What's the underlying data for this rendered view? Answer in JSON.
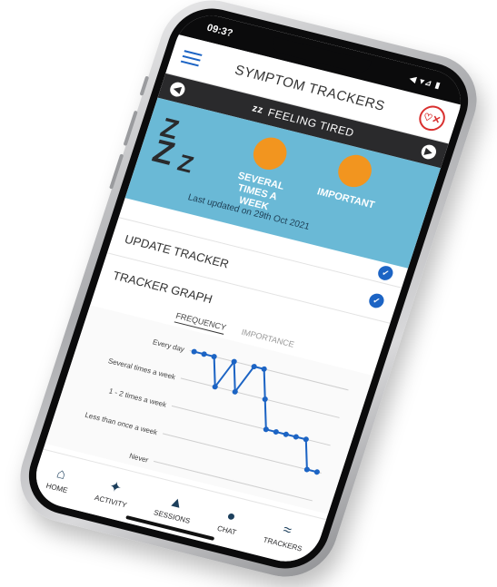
{
  "status_bar": {
    "time": "09:3?",
    "icons": "◀ ▾⊿ ▮"
  },
  "app_bar": {
    "title": "SYMPTOM TRACKERS",
    "logo_glyph": "♡✕"
  },
  "tracker_header": {
    "title": "FEELING TIRED",
    "icon_glyph": "zz"
  },
  "summary": {
    "frequency": "SEVERAL TIMES A WEEK",
    "importance": "IMPORTANT",
    "last_updated": "Last updated on 29th Oct 2021",
    "accent_color": "#f2951f",
    "panel_color": "#6ab9d6"
  },
  "sections": {
    "update_tracker": "UPDATE TRACKER",
    "tracker_graph": "TRACKER GRAPH"
  },
  "graph_tabs": {
    "frequency": "FREQUENCY",
    "importance": "IMPORTANCE"
  },
  "chart_data": {
    "type": "line",
    "categories": [
      "Never",
      "Less than once a week",
      "1 - 2 times a week",
      "Several times a week",
      "Every day"
    ],
    "values": [
      4,
      4,
      4,
      3,
      4,
      3,
      4,
      4,
      3,
      2,
      2,
      2,
      2,
      2,
      1,
      1
    ],
    "color": "#1c64c4"
  },
  "bottom_nav": {
    "home": "HOME",
    "activity": "ACTIVITY",
    "sessions": "SESSIONS",
    "chat": "CHAT",
    "trackers": "TRACKERS"
  }
}
